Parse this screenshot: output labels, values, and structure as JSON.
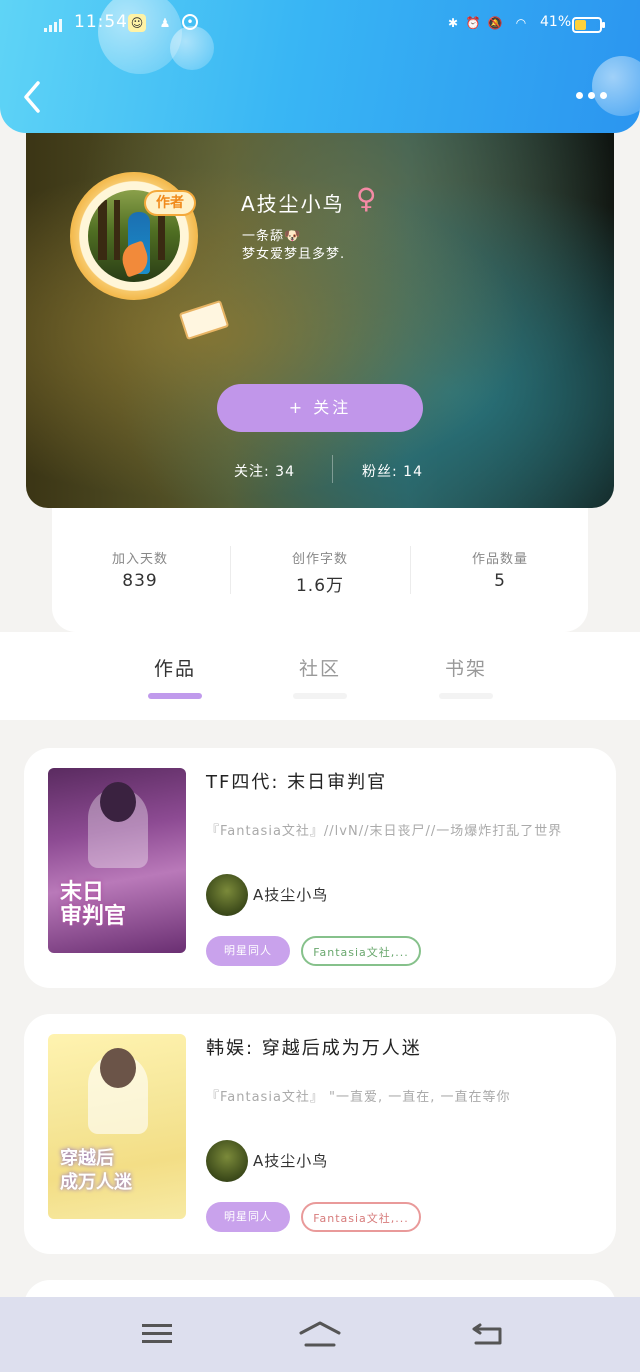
{
  "status_bar": {
    "time": "11:54",
    "battery_percent": "41%"
  },
  "header": {
    "back_icon": "chevron-left-icon",
    "more_icon": "more-dots-icon"
  },
  "profile": {
    "badge": "作者",
    "nickname": "A技尘小鸟",
    "gender_symbol": "♀",
    "bio": "一条舔🐶\n梦女爱梦且多梦.",
    "follow_button": "+  关注",
    "following": "关注: 34",
    "followers": "粉丝: 14"
  },
  "stats": [
    {
      "label": "加入天数",
      "value": "839"
    },
    {
      "label": "创作字数",
      "value": "1.6万"
    },
    {
      "label": "作品数量",
      "value": "5"
    }
  ],
  "tabs": [
    {
      "label": "作品",
      "active": true
    },
    {
      "label": "社区",
      "active": false
    },
    {
      "label": "书架",
      "active": false
    }
  ],
  "works": [
    {
      "title": "TF四代: 末日审判官",
      "description": "『Fantasia文社』//lvN//末日丧尸//一场爆炸打乱了世界",
      "cover_text": "末日\n审判官",
      "author": "A技尘小鸟",
      "tags": [
        "明星同人",
        "Fantasia文社,..."
      ]
    },
    {
      "title": "韩娱: 穿越后成为万人迷",
      "description": "『Fantasia文社』 \"一直爱, 一直在, 一直在等你",
      "cover_text": "穿越后\n成万人迷",
      "author": "A技尘小鸟",
      "tags": [
        "明星同人",
        "Fantasia文社,..."
      ]
    }
  ],
  "nav": {
    "menu_icon": "menu-icon",
    "home_icon": "home-icon",
    "back_icon": "back-icon"
  },
  "colors": {
    "header_gradient_start": "#5fd4f6",
    "header_gradient_end": "#2b95f0",
    "accent_purple": "#c196ea",
    "tag_green": "#86c18b",
    "tag_red": "#e99a9a"
  }
}
